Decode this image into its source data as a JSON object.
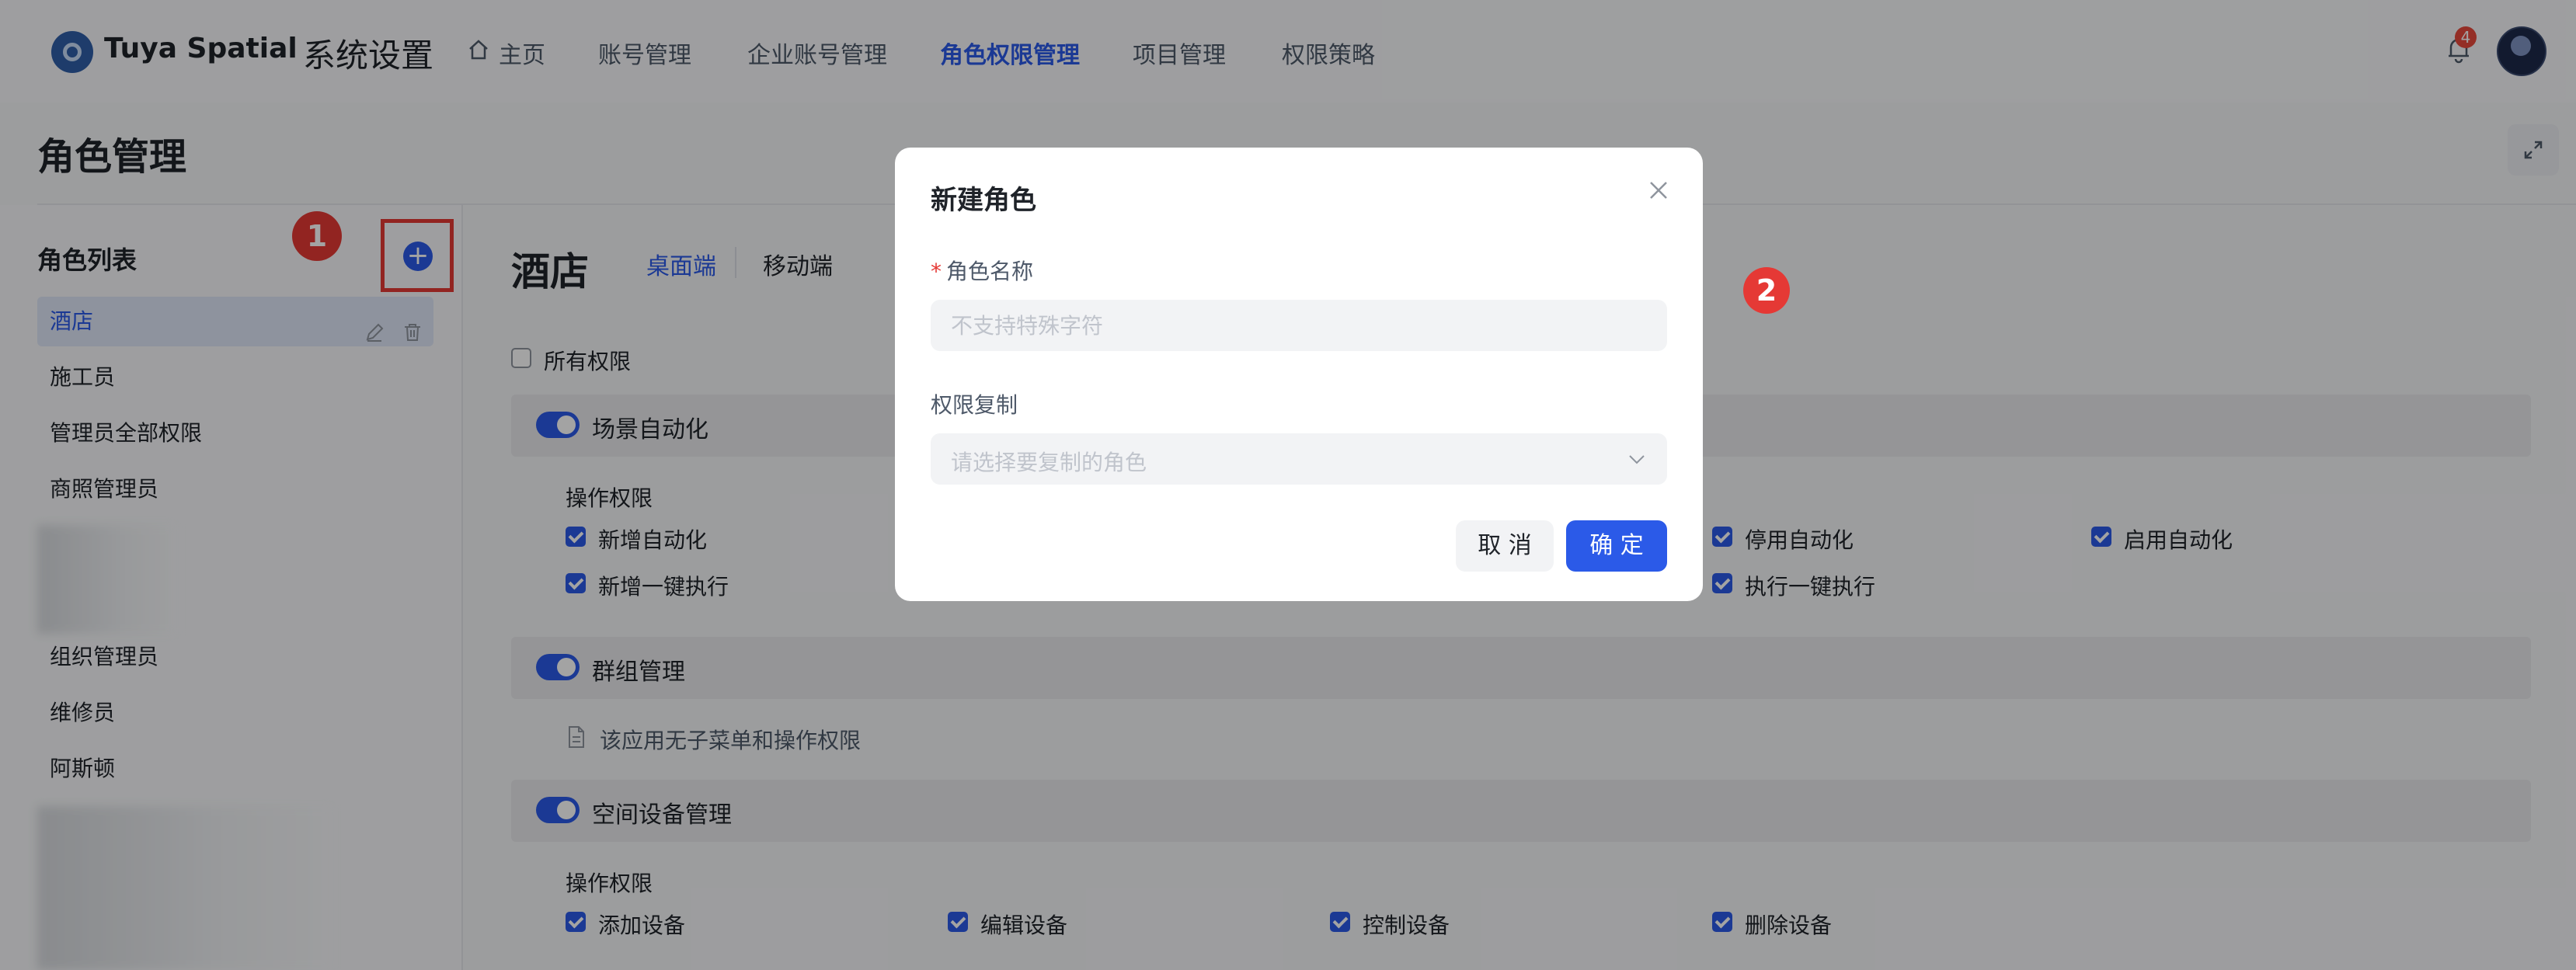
{
  "app": {
    "brand": "Tuya Spatial",
    "system_title": "系统设置",
    "notification_count": "4"
  },
  "nav": {
    "items": [
      "主页",
      "账号管理",
      "企业账号管理",
      "角色权限管理",
      "项目管理",
      "权限策略"
    ],
    "active": "角色权限管理"
  },
  "page": {
    "title": "角色管理"
  },
  "sidebar": {
    "title": "角色列表",
    "roles": [
      "酒店",
      "施工员",
      "管理员全部权限",
      "商照管理员",
      "组织管理员",
      "维修员",
      "阿斯顿"
    ],
    "active_role": "酒店"
  },
  "markers": [
    "1",
    "2"
  ],
  "main": {
    "title": "酒店",
    "tabs": [
      "桌面端",
      "移动端"
    ],
    "all_permissions_label": "所有权限",
    "sections": [
      {
        "name": "场景自动化",
        "subtitle": "操作权限",
        "rows": [
          [
            "新增自动化",
            "停用自动化",
            "启用自动化"
          ],
          [
            "新增一键执行",
            "执行一键执行"
          ]
        ]
      },
      {
        "name": "群组管理",
        "note": "该应用无子菜单和操作权限"
      },
      {
        "name": "空间设备管理",
        "subtitle": "操作权限",
        "rows": [
          [
            "添加设备",
            "编辑设备",
            "控制设备",
            "删除设备"
          ]
        ]
      }
    ]
  },
  "modal": {
    "title": "新建角色",
    "name_label": "角色名称",
    "name_placeholder": "不支持特殊字符",
    "copy_label": "权限复制",
    "copy_placeholder": "请选择要复制的角色",
    "cancel": "取 消",
    "confirm": "确 定"
  },
  "colors": {
    "accent": "#2b5ae8",
    "marker": "#e53935"
  }
}
